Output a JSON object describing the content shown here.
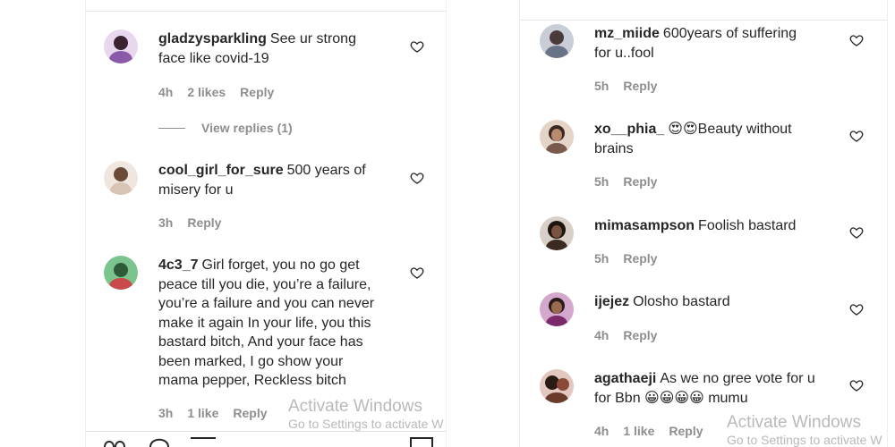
{
  "left_panel": {
    "comments": [
      {
        "username": "gladzysparkling",
        "text_lines": [
          "See ur strong",
          "face like covid-19"
        ],
        "time": "4h",
        "likes": "2 likes",
        "reply": "Reply",
        "view_replies": "View replies (1)",
        "avatar_color": "#8a5aa8"
      },
      {
        "username": "cool_girl_for_sure",
        "text_lines": [
          "500 years of",
          "misery for u"
        ],
        "time": "3h",
        "likes": "",
        "reply": "Reply",
        "avatar_color": "#b89a88"
      },
      {
        "username": "4c3_7",
        "text_lines": [
          "Girl forget, you no go get",
          "peace till you die, you’re a failure,",
          "you’re a failure and you can never",
          "make it again In your life, you this",
          "bastard bitch, And your face has",
          "been marked, I go show your",
          "mama pepper, Reckless bitch"
        ],
        "time": "3h",
        "likes": "1 like",
        "reply": "Reply",
        "avatar_color": "#5ea872"
      }
    ],
    "watermark": {
      "title": "Activate Windows",
      "subtitle": "Go to Settings to activate W"
    }
  },
  "right_panel": {
    "comments": [
      {
        "username": "mz_miide",
        "text_lines": [
          "600years of suffering",
          "for u..fool"
        ],
        "time": "5h",
        "likes": "",
        "reply": "Reply",
        "avatar_color": "#6a7288"
      },
      {
        "username": "xo__phia_",
        "emoji_prefix": [
          "😍",
          "😍"
        ],
        "text_lines": [
          "Beauty without",
          "brains"
        ],
        "time": "5h",
        "likes": "",
        "reply": "Reply",
        "avatar_color": "#7a5a4c"
      },
      {
        "username": "mimasampson",
        "text_lines": [
          "Foolish bastard"
        ],
        "time": "5h",
        "likes": "",
        "reply": "Reply",
        "avatar_color": "#3a2a22"
      },
      {
        "username": "ijejez",
        "text_lines": [
          "Olosho bastard"
        ],
        "time": "4h",
        "likes": "",
        "reply": "Reply",
        "avatar_color": "#7a2a6a"
      },
      {
        "username": "agathaeji",
        "text_lines": [
          "As we no gree vote for u",
          "for Bbn 😀😀😀😀 mumu"
        ],
        "time": "4h",
        "likes": "1 like",
        "reply": "Reply",
        "avatar_color": "#8a4a38"
      }
    ],
    "watermark": {
      "title": "Activate Windows",
      "subtitle": "Go to Settings to activate W"
    }
  },
  "colors": {
    "text": "#262626",
    "meta": "#8e8e8e",
    "watermark": "#b9b9b9"
  }
}
